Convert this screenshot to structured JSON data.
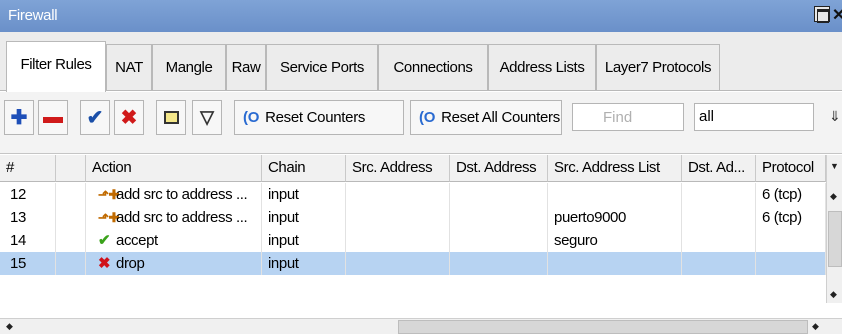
{
  "window": {
    "title": "Firewall"
  },
  "tabs": [
    {
      "label": "Filter Rules",
      "active": true
    },
    {
      "label": "NAT"
    },
    {
      "label": "Mangle"
    },
    {
      "label": "Raw"
    },
    {
      "label": "Service Ports"
    },
    {
      "label": "Connections"
    },
    {
      "label": "Address Lists"
    },
    {
      "label": "Layer7 Protocols"
    }
  ],
  "toolbar": {
    "add_icon": "plus-icon",
    "remove_icon": "minus-icon",
    "enable_icon": "check-icon",
    "disable_icon": "x-icon",
    "comment_icon": "note-icon",
    "filter_icon": "filter-icon",
    "reset_counters_label": "Reset Counters",
    "reset_all_counters_label": "Reset All Counters",
    "find_placeholder": "Find",
    "select_value": "all"
  },
  "table": {
    "columns": [
      "#",
      "",
      "Action",
      "Chain",
      "Src. Address",
      "Dst. Address",
      "Src. Address List",
      "Dst. Ad...",
      "Protocol"
    ],
    "rows": [
      {
        "num": "12",
        "action_icon": "add-to-list-icon",
        "action": "add src to address ...",
        "chain": "input",
        "src_address": "",
        "dst_address": "",
        "src_address_list": "",
        "dst_address_list": "",
        "protocol": "6 (tcp)",
        "selected": false
      },
      {
        "num": "13",
        "action_icon": "add-to-list-icon",
        "action": "add src to address ...",
        "chain": "input",
        "src_address": "",
        "dst_address": "",
        "src_address_list": "puerto9000",
        "dst_address_list": "",
        "protocol": "6 (tcp)",
        "selected": false
      },
      {
        "num": "14",
        "action_icon": "accept-icon",
        "action": "accept",
        "chain": "input",
        "src_address": "",
        "dst_address": "",
        "src_address_list": "seguro",
        "dst_address_list": "",
        "protocol": "",
        "selected": false
      },
      {
        "num": "15",
        "action_icon": "drop-icon",
        "action": "drop",
        "chain": "input",
        "src_address": "",
        "dst_address": "",
        "src_address_list": "",
        "dst_address_list": "",
        "protocol": "",
        "selected": true
      }
    ]
  },
  "colors": {
    "titlebar": "#6a90c9",
    "selected_row": "#b7d3f2",
    "add_icon": "#1e4fb8",
    "remove_icon": "#d01a1a"
  }
}
